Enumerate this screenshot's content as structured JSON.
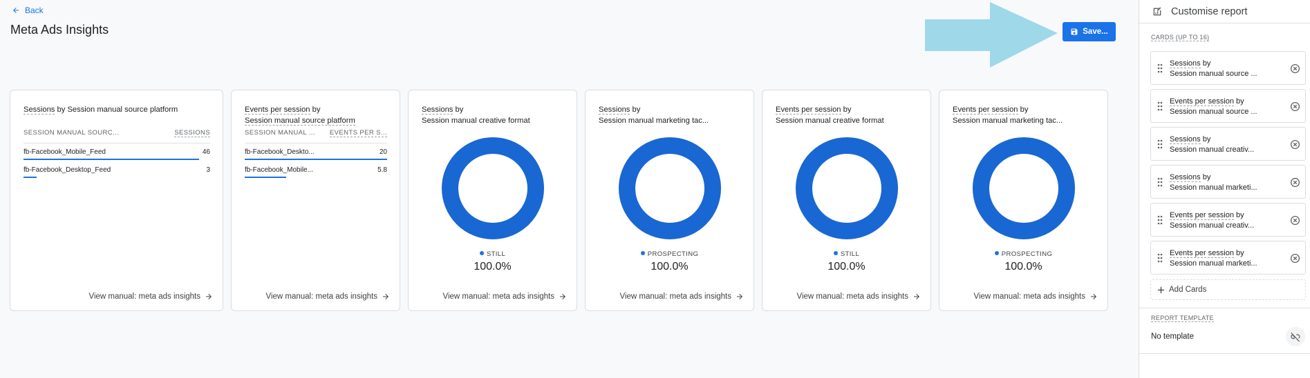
{
  "header": {
    "back_label": "Back",
    "title": "Meta Ads Insights",
    "save_label": "Save..."
  },
  "cards": [
    {
      "title_metric": "Sessions",
      "title_rest": " by Session manual source platform",
      "col1": "SESSION MANUAL SOURC...",
      "col2": "SESSIONS",
      "rows": [
        {
          "label": "fb-Facebook_Mobile_Feed",
          "value": "46",
          "fill": 0.94
        },
        {
          "label": "fb-Facebook_Desktop_Feed",
          "value": "3",
          "fill": 0.07
        }
      ],
      "link": "View manual: meta ads insights"
    },
    {
      "title_metric": "Events per session",
      "title_rest": " by",
      "title_line2": "Session manual source platform",
      "col1": "SESSION MANUAL ...",
      "col2": "EVENTS PER S...",
      "rows": [
        {
          "label": "fb-Facebook_Deskto...",
          "value": "20",
          "fill": 1.0
        },
        {
          "label": "fb-Facebook_Mobile...",
          "value": "5.8",
          "fill": 0.29
        }
      ],
      "link": "View manual: meta ads insights"
    },
    {
      "title_metric": "Sessions",
      "title_rest": " by",
      "title_line2": "Session manual creative format",
      "legend": "STILL",
      "percent": "100.0%",
      "share": 1.0,
      "link": "View manual: meta ads insights"
    },
    {
      "title_metric": "Sessions",
      "title_rest": " by",
      "title_line2": "Session manual marketing tac...",
      "legend": "PROSPECTING",
      "percent": "100.0%",
      "share": 1.0,
      "link": "View manual: meta ads insights"
    },
    {
      "title_metric": "Events per session",
      "title_rest": " by",
      "title_line2": "Session manual creative format",
      "legend": "STILL",
      "percent": "100.0%",
      "share": 1.0,
      "link": "View manual: meta ads insights"
    },
    {
      "title_metric": "Events per session",
      "title_rest": " by",
      "title_line2": "Session manual marketing tac...",
      "legend": "PROSPECTING",
      "percent": "100.0%",
      "share": 1.0,
      "link": "View manual: meta ads insights"
    }
  ],
  "panel": {
    "title": "Customise report",
    "cards_label": "CARDS (UP TO 16)",
    "cards": [
      {
        "metric": "Sessions",
        "rest": " by",
        "line2": "Session manual source ..."
      },
      {
        "metric": "Events per session",
        "rest": " by",
        "line2": "Session manual source ..."
      },
      {
        "metric": "Sessions",
        "rest": " by",
        "line2": "Session manual creativ..."
      },
      {
        "metric": "Sessions",
        "rest": " by",
        "line2": "Session manual marketi..."
      },
      {
        "metric": "Events per session",
        "rest": " by",
        "line2": "Session manual creativ..."
      },
      {
        "metric": "Events per session",
        "rest": " by",
        "line2": "Session manual marketi..."
      }
    ],
    "add_cards_label": "Add Cards",
    "template_label": "REPORT TEMPLATE",
    "template_value": "No template"
  },
  "colors": {
    "accent": "#1a73e8",
    "donut": "#1967d2",
    "arrow": "#9fd8e9"
  }
}
